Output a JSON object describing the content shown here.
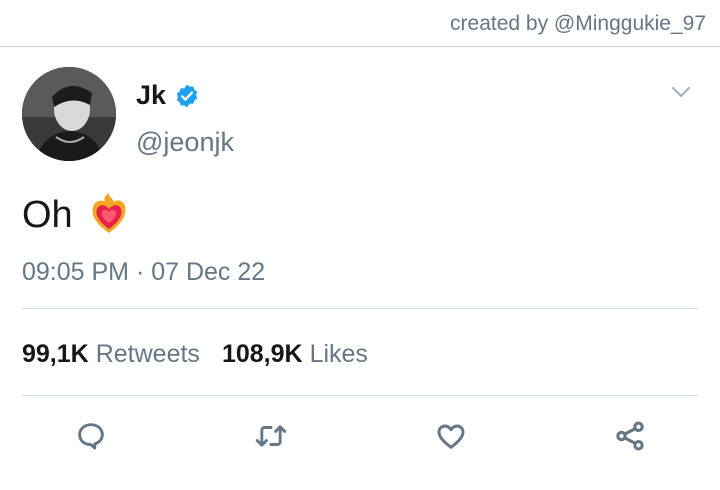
{
  "watermark": "created by @Minggukie_97",
  "author": {
    "display_name": "Jk",
    "handle": "@jeonjk",
    "verified": true
  },
  "tweet": {
    "text": "Oh",
    "emoji": "heart-on-fire-emoji",
    "timestamp": "09:05 PM · 07 Dec 22"
  },
  "stats": {
    "retweets_count": "99,1K",
    "retweets_label": "Retweets",
    "likes_count": "108,9K",
    "likes_label": "Likes"
  },
  "actions": [
    "reply-icon",
    "retweet-icon",
    "like-icon",
    "share-icon"
  ],
  "colors": {
    "text": "#14171a",
    "secondary": "#657786",
    "verified": "#1da1f2",
    "divider": "#d6dde3"
  }
}
